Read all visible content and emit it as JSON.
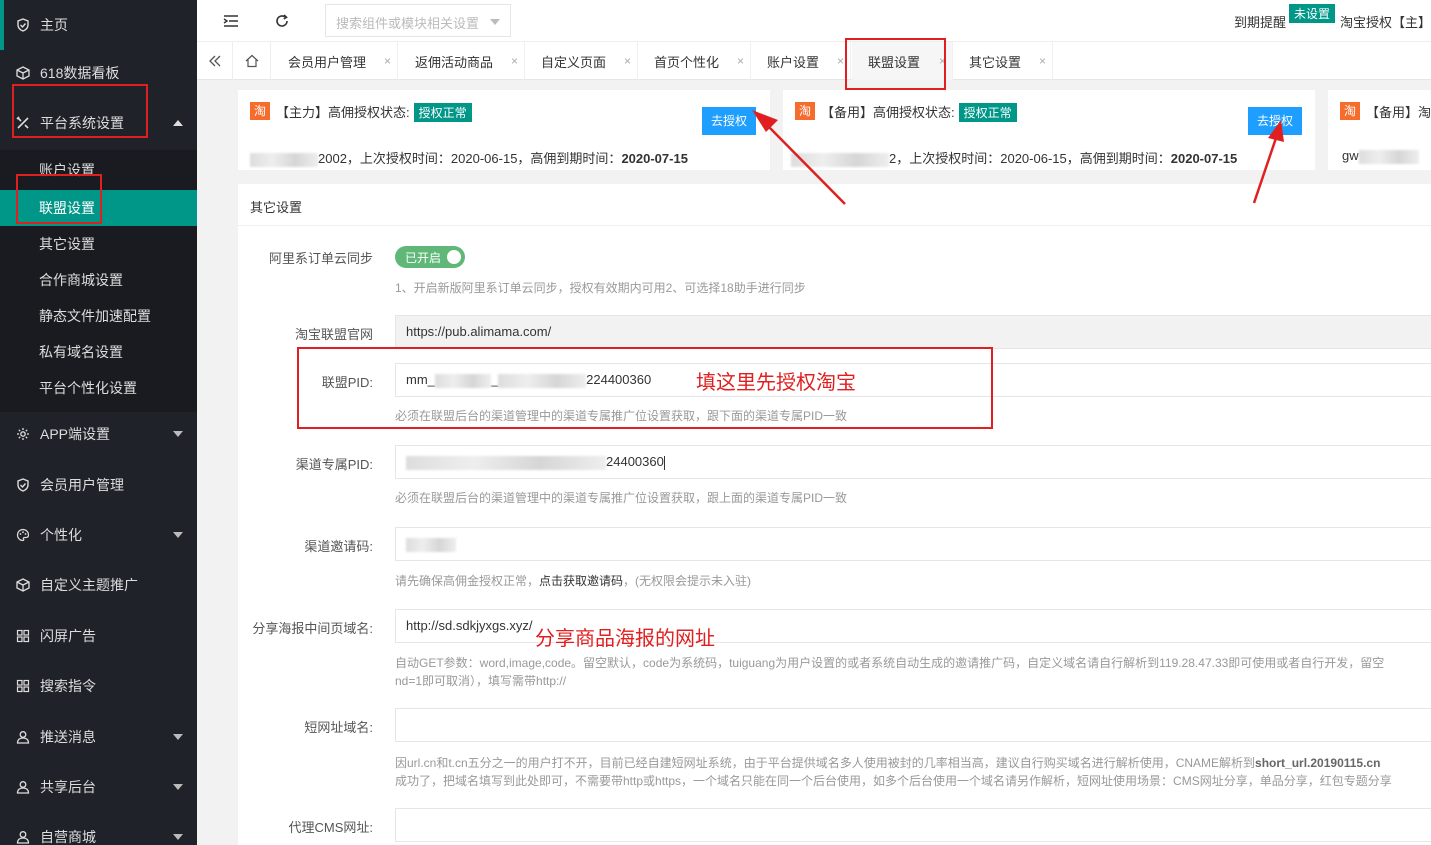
{
  "sidebar": {
    "home": "主页",
    "dashboard": "618数据看板",
    "platform_settings": "平台系统设置",
    "sub": [
      "账户设置",
      "联盟设置",
      "其它设置",
      "合作商城设置",
      "静态文件加速配置",
      "私有域名设置",
      "平台个性化设置"
    ],
    "app": "APP端设置",
    "members": "会员用户管理",
    "personal": "个性化",
    "theme": "自定义主题推广",
    "splash": "闪屏广告",
    "search_cmd": "搜索指令",
    "push": "推送消息",
    "shared_backend": "共享后台",
    "mall": "自营商城"
  },
  "header": {
    "search_placeholder": "搜索组件或模块相关设置",
    "expire_label": "到期提醒",
    "not_set": "未设置",
    "tao_auth": "淘宝授权【主】"
  },
  "tabs": [
    "会员用户管理",
    "返佣活动商品",
    "自定义页面",
    "首页个性化",
    "账户设置",
    "联盟设置",
    "其它设置"
  ],
  "tab_close": "×",
  "auth": {
    "tao": "淘",
    "main_title": "【主力】高佣授权状态:",
    "backup_title": "【备用】高佣授权状态:",
    "backup2_title": "【备用】淘",
    "ok": "授权正常",
    "btn": "去授权",
    "main_info_end": "2002，上次授权时间：",
    "backup_info_end": "2，上次授权时间：",
    "last_time": "2020-06-15",
    "expire_label": "，高佣到期时间：",
    "expire_time": "2020-07-15",
    "card3_info": "gw"
  },
  "panel": {
    "title": "其它设置",
    "ali_sync_label": "阿里系订单云同步",
    "ali_sync_state": "已开启",
    "ali_sync_help": "1、开启新版阿里系订单云同步，授权有效期内可用2、可选择18助手进行同步",
    "alimama_label": "淘宝联盟官网",
    "alimama_value": "https://pub.alimama.com/",
    "pid_label": "联盟PID:",
    "pid_prefix": "mm_",
    "pid_mid": "_",
    "pid_suffix": "224400360",
    "pid_help": "必须在联盟后台的渠道管理中的渠道专属推广位设置获取，跟下面的渠道专属PID一致",
    "channel_pid_label": "渠道专属PID:",
    "channel_pid_suffix": "24400360",
    "channel_pid_help": "必须在联盟后台的渠道管理中的渠道专属推广位设置获取，跟上面的渠道专属PID一致",
    "invite_label": "渠道邀请码:",
    "invite_help_1": "请先确保高佣金授权正常，",
    "invite_help_link": "点击获取邀请码",
    "invite_help_2": "，(无权限会提示未入驻)",
    "share_label": "分享海报中间页域名:",
    "share_value": "http://sd.sdkjyxgs.xyz/",
    "share_help_1": "自动GET参数：word,image,code。留空默认，code为系统码，tuiguang为用户设置的或者系统自动生成的邀请推广码，自定义域名请自行解析到119.28.47.33即可使用或者自行开发，留空",
    "share_help_2": "nd=1即可取消），填写需带http://",
    "short_label": "短网址域名:",
    "short_help_1": "因url.cn和t.cn五分之一的用户打不开，目前已经自建短网址系统，由于平台提供域名多人使用被封的几率相当高，建议自行购买域名进行解析使用，CNAME解析到",
    "short_help_bold": "short_url.20190115.cn",
    "short_help_2": "成功了，把域名填写到此处即可，不需要带http或https，一个域名只能在同一个后台使用，如多个后台使用一个域名请另作解析，短网址使用场景：CMS网址分享，单品分享，红包专题分享",
    "cms_label": "代理CMS网址:"
  },
  "annotations": {
    "pid_note": "填这里先授权淘宝",
    "share_note": "分享商品海报的网址"
  },
  "colors": {
    "accent": "#009688",
    "sidebar_bg": "#20222a",
    "annotation": "#e02020",
    "button_blue": "#1e9fff"
  }
}
